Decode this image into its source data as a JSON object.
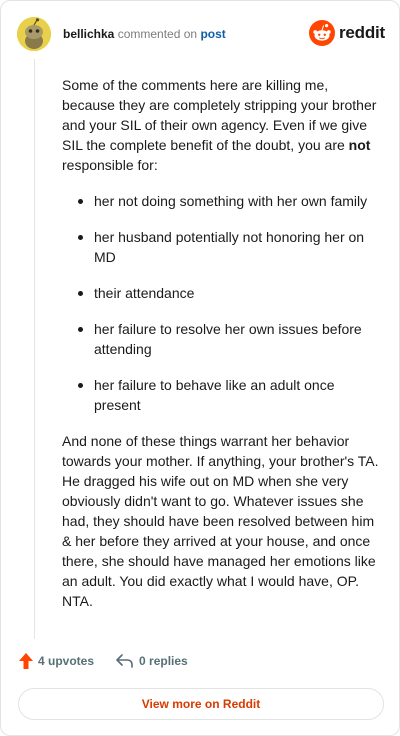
{
  "header": {
    "username": "bellichka",
    "action": "commented on",
    "target": "post",
    "brand": "reddit"
  },
  "comment": {
    "intro": "Some of the comments here are killing me, because they are completely stripping your brother and your SIL of their own agency. Even if we give SIL the complete benefit of the doubt, you are ",
    "intro_bold": "not",
    "intro_end": " responsible for:",
    "items": [
      "her not doing something with her own family",
      "her husband potentially not honoring her on MD",
      "their attendance",
      "her failure to resolve her own issues before attending",
      "her failure to behave like an adult once present"
    ],
    "closing": "And none of these things warrant her behavior towards your mother. If anything, your brother's TA. He dragged his wife out on MD when she very obviously didn't want to go. Whatever issues she had, they should have been resolved between him & her before they arrived at your house, and once there, she should have managed her emotions like an adult. You did exactly what I would have, OP. NTA."
  },
  "footer": {
    "upvotes": "4 upvotes",
    "replies": "0 replies"
  },
  "cta": {
    "label": "View more on Reddit"
  },
  "colors": {
    "brand_orange": "#ff4500",
    "cta_text": "#d93a00",
    "link_blue": "#0f5ea8",
    "avatar_bg": "#e9d04a"
  },
  "icons": {
    "avatar": "snoo-avatar-icon",
    "brand": "reddit-logo-icon",
    "upvote": "upvote-arrow-icon",
    "reply": "reply-arrow-icon"
  }
}
